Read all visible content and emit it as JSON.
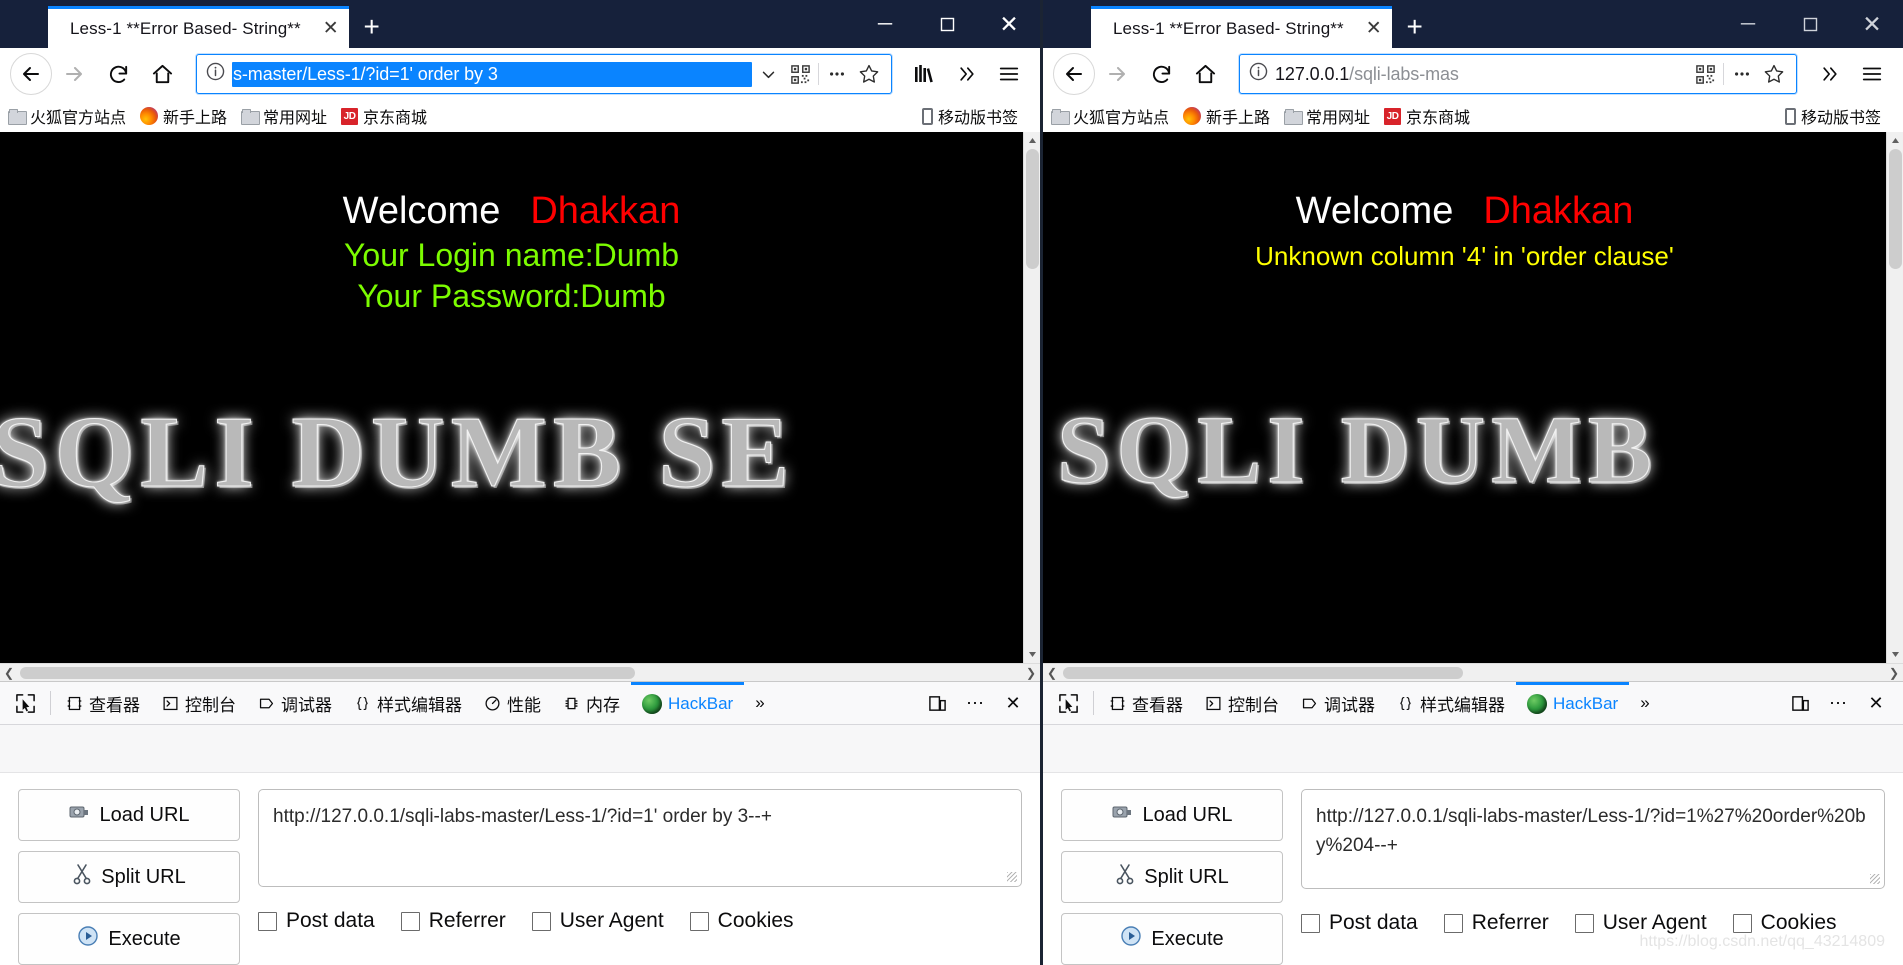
{
  "windows": {
    "left": {
      "tab": {
        "title": "Less-1 **Error Based- String**",
        "close": "✕"
      },
      "newtab": "+",
      "controls": {
        "minimize": "─",
        "maximize": "□",
        "close": "✕"
      },
      "urlbar": {
        "value": "s-master/Less-1/?id=1' order by 3",
        "selected": true
      },
      "bookmarks": [
        {
          "label": "火狐官方站点",
          "icon": "folder-icon"
        },
        {
          "label": "新手上路",
          "icon": "firefox-icon"
        },
        {
          "label": "常用网址",
          "icon": "folder-icon"
        },
        {
          "label": "京东商城",
          "icon": "jd-icon"
        }
      ],
      "bookmarks_right": {
        "label": "移动版书签",
        "icon": "mobile-icon"
      },
      "page": {
        "welcome": "Welcome",
        "name": "Dhakkan",
        "line1": "Your Login name:Dumb",
        "line2": "Your Password:Dumb",
        "art": "SQLI DUMB SE"
      },
      "devtools": {
        "tabs": [
          {
            "label": "查看器",
            "active": false
          },
          {
            "label": "控制台",
            "active": false
          },
          {
            "label": "调试器",
            "active": false
          },
          {
            "label": "样式编辑器",
            "active": false
          },
          {
            "label": "性能",
            "active": false
          },
          {
            "label": "内存",
            "active": false
          },
          {
            "label": "HackBar",
            "active": true
          }
        ],
        "overflow": "»",
        "dock": "❐",
        "more": "⋯",
        "close": "✕"
      },
      "hackbar": {
        "load_url": "Load URL",
        "split_url": "Split URL",
        "execute": "Execute",
        "url_value": "http://127.0.0.1/sqli-labs-master/Less-1/?id=1' order by 3--+",
        "checks": [
          "Post data",
          "Referrer",
          "User Agent",
          "Cookies"
        ]
      }
    },
    "right": {
      "tab": {
        "title": "Less-1 **Error Based- String**",
        "close": "✕"
      },
      "newtab": "+",
      "controls": {
        "minimize": "─",
        "maximize": "□",
        "close": "✕"
      },
      "urlbar": {
        "value": "127.0.0.1",
        "value_dim": "/sqli-labs-mas",
        "selected": false
      },
      "bookmarks": [
        {
          "label": "火狐官方站点",
          "icon": "folder-icon"
        },
        {
          "label": "新手上路",
          "icon": "firefox-icon"
        },
        {
          "label": "常用网址",
          "icon": "folder-icon"
        },
        {
          "label": "京东商城",
          "icon": "jd-icon"
        }
      ],
      "bookmarks_right": {
        "label": "移动版书签",
        "icon": "mobile-icon"
      },
      "page": {
        "welcome": "Welcome",
        "name": "Dhakkan",
        "error": "Unknown column '4' in 'order clause'",
        "art": "SQLI DUMB"
      },
      "devtools": {
        "tabs": [
          {
            "label": "查看器",
            "active": false
          },
          {
            "label": "控制台",
            "active": false
          },
          {
            "label": "调试器",
            "active": false
          },
          {
            "label": "样式编辑器",
            "active": false
          },
          {
            "label": "HackBar",
            "active": true
          }
        ],
        "overflow": "»",
        "dock": "❐",
        "more": "⋯",
        "close": "✕"
      },
      "hackbar": {
        "load_url": "Load URL",
        "split_url": "Split URL",
        "execute": "Execute",
        "url_value": "http://127.0.0.1/sqli-labs-master/Less-1/?id=1%27%20order%20by%204--+",
        "checks": [
          "Post data",
          "Referrer",
          "User Agent",
          "Cookies"
        ]
      }
    }
  },
  "watermark": "https://blog.csdn.net/qq_43214809",
  "colors": {
    "titlebar": "#16213b",
    "accent": "#0a84ff",
    "page_bg": "#000000",
    "name_red": "#ff0000",
    "green": "#7cfc00",
    "yellow": "#ffff00"
  }
}
